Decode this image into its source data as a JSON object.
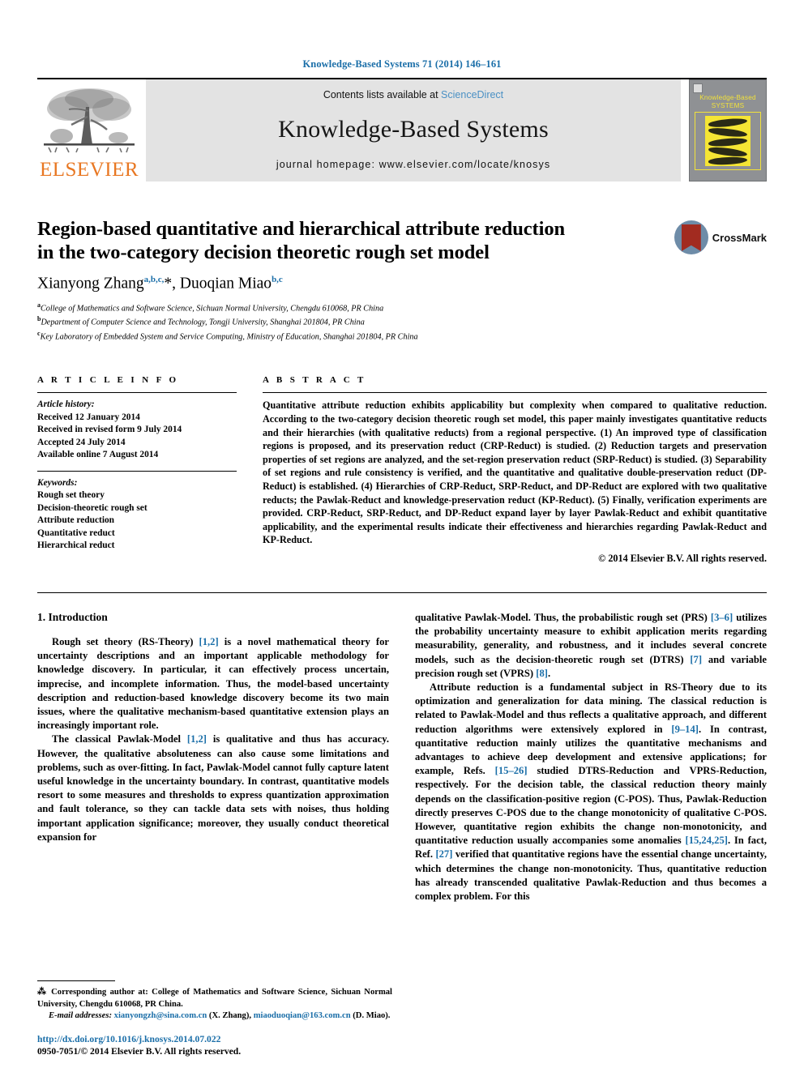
{
  "running_head": "Knowledge-Based Systems 71 (2014) 146–161",
  "masthead": {
    "publisher_name": "ELSEVIER",
    "contents_prefix": "Contents lists available at ",
    "sciencedirect": "ScienceDirect",
    "journal_name": "Knowledge-Based Systems",
    "homepage": "journal homepage: www.elsevier.com/locate/knosys",
    "cover_title_line1": "Knowledge-Based",
    "cover_title_line2": "SYSTEMS",
    "accent_blue": "#4a90c4",
    "elsevier_orange": "#E87722",
    "cover_yellow": "#f2e23a",
    "cover_gray": "#8f9194"
  },
  "title_block": {
    "title_line1": "Region-based quantitative and hierarchical attribute reduction",
    "title_line2": "in the two-category decision theoretic rough set model",
    "author1": "Xianyong Zhang",
    "author1_sup": "a,b,c,",
    "author1_star": "*",
    "author_sep": ", ",
    "author2": "Duoqian Miao",
    "author2_sup": "b,c",
    "affiliations": [
      {
        "marker": "a",
        "text": "College of Mathematics and Software Science, Sichuan Normal University, Chengdu 610068, PR China"
      },
      {
        "marker": "b",
        "text": "Department of Computer Science and Technology, Tongji University, Shanghai 201804, PR China"
      },
      {
        "marker": "c",
        "text": "Key Laboratory of Embedded System and Service Computing, Ministry of Education, Shanghai 201804, PR China"
      }
    ],
    "crossmark_label": "CrossMark"
  },
  "article_info": {
    "heading": "A R T I C L E   I N F O",
    "history_label": "Article history:",
    "history": [
      "Received 12 January 2014",
      "Received in revised form 9 July 2014",
      "Accepted 24 July 2014",
      "Available online 7 August 2014"
    ],
    "keywords_label": "Keywords:",
    "keywords": [
      "Rough set theory",
      "Decision-theoretic rough set",
      "Attribute reduction",
      "Quantitative reduct",
      "Hierarchical reduct"
    ]
  },
  "abstract": {
    "heading": "A B S T R A C T",
    "text": "Quantitative attribute reduction exhibits applicability but complexity when compared to qualitative reduction. According to the two-category decision theoretic rough set model, this paper mainly investigates quantitative reducts and their hierarchies (with qualitative reducts) from a regional perspective. (1) An improved type of classification regions is proposed, and its preservation reduct (CRP-Reduct) is studied. (2) Reduction targets and preservation properties of set regions are analyzed, and the set-region preservation reduct (SRP-Reduct) is studied. (3) Separability of set regions and rule consistency is verified, and the quantitative and qualitative double-preservation reduct (DP-Reduct) is established. (4) Hierarchies of CRP-Reduct, SRP-Reduct, and DP-Reduct are explored with two qualitative reducts; the Pawlak-Reduct and knowledge-preservation reduct (KP-Reduct). (5) Finally, verification experiments are provided. CRP-Reduct, SRP-Reduct, and DP-Reduct expand layer by layer Pawlak-Reduct and exhibit quantitative applicability, and the experimental results indicate their effectiveness and hierarchies regarding Pawlak-Reduct and KP-Reduct.",
    "copyright": "© 2014 Elsevier B.V. All rights reserved."
  },
  "body": {
    "section_title": "1. Introduction",
    "left_paragraphs": [
      {
        "segments": [
          {
            "t": "Rough set theory (RS-Theory) "
          },
          {
            "t": "[1,2]",
            "ref": true
          },
          {
            "t": " is a novel mathematical theory for uncertainty descriptions and an important applicable methodology for knowledge discovery. In particular, it can effectively process uncertain, imprecise, and incomplete information. Thus, the model-based uncertainty description and reduction-based knowledge discovery become its two main issues, where the qualitative mechanism-based quantitative extension plays an increasingly important role."
          }
        ]
      },
      {
        "segments": [
          {
            "t": "The classical Pawlak-Model "
          },
          {
            "t": "[1,2]",
            "ref": true
          },
          {
            "t": " is qualitative and thus has accuracy. However, the qualitative absoluteness can also cause some limitations and problems, such as over-fitting. In fact, Pawlak-Model cannot fully capture latent useful knowledge in the uncertainty boundary. In contrast, quantitative models resort to some measures and thresholds to express quantization approximation and fault tolerance, so they can tackle data sets with noises, thus holding important application significance; moreover, they usually conduct theoretical expansion for"
          }
        ]
      }
    ],
    "right_paragraphs": [
      {
        "no_indent": true,
        "segments": [
          {
            "t": "qualitative Pawlak-Model. Thus, the probabilistic rough set (PRS) "
          },
          {
            "t": "[3–6]",
            "ref": true
          },
          {
            "t": " utilizes the probability uncertainty measure to exhibit application merits regarding measurability, generality, and robustness, and it includes several concrete models, such as the decision-theoretic rough set (DTRS) "
          },
          {
            "t": "[7]",
            "ref": true
          },
          {
            "t": " and variable precision rough set (VPRS) "
          },
          {
            "t": "[8]",
            "ref": true
          },
          {
            "t": "."
          }
        ]
      },
      {
        "segments": [
          {
            "t": "Attribute reduction is a fundamental subject in RS-Theory due to its optimization and generalization for data mining. The classical reduction is related to Pawlak-Model and thus reflects a qualitative approach, and different reduction algorithms were extensively explored in "
          },
          {
            "t": "[9–14]",
            "ref": true
          },
          {
            "t": ". In contrast, quantitative reduction mainly utilizes the quantitative mechanisms and advantages to achieve deep development and extensive applications; for example, Refs. "
          },
          {
            "t": "[15–26]",
            "ref": true
          },
          {
            "t": " studied DTRS-Reduction and VPRS-Reduction, respectively. For the decision table, the classical reduction theory mainly depends on the classification-positive region (C-POS). Thus, Pawlak-Reduction directly preserves C-POS due to the change monotonicity of qualitative C-POS. However, quantitative region exhibits the change non-monotonicity, and quantitative reduction usually accompanies some anomalies "
          },
          {
            "t": "[15,24,25]",
            "ref": true
          },
          {
            "t": ". In fact, Ref. "
          },
          {
            "t": "[27]",
            "ref": true
          },
          {
            "t": " verified that quantitative regions have the essential change uncertainty, which determines the change non-monotonicity. Thus, quantitative reduction has already transcended qualitative Pawlak-Reduction and thus becomes a complex problem. For this"
          }
        ]
      }
    ]
  },
  "footnote": {
    "star": "⁂",
    "corresponding": " Corresponding author at: College of Mathematics and Software Science, Sichuan Normal University, Chengdu 610068, PR China.",
    "email_label": "E-mail addresses:",
    "email1": "xianyongzh@sina.com.cn",
    "email1_owner": " (X. Zhang), ",
    "email2": "miaoduoqian@163.com.cn",
    "email2_owner": " (D. Miao)."
  },
  "doi_block": {
    "doi": "http://dx.doi.org/10.1016/j.knosys.2014.07.022",
    "issn": "0950-7051/© 2014 Elsevier B.V. All rights reserved."
  }
}
